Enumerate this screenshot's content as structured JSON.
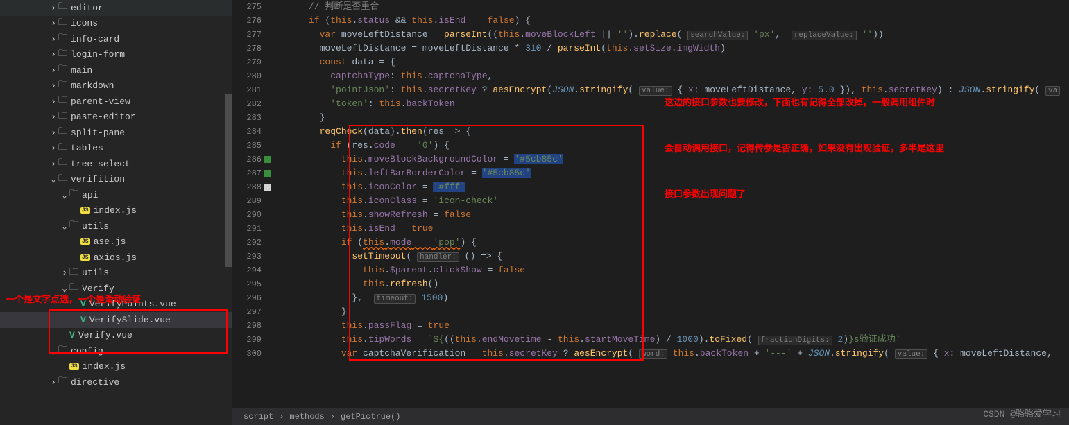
{
  "sidebar": {
    "items": [
      {
        "label": "editor",
        "type": "folder",
        "chevron": "right",
        "indent": 1
      },
      {
        "label": "icons",
        "type": "folder",
        "chevron": "right",
        "indent": 1
      },
      {
        "label": "info-card",
        "type": "folder",
        "chevron": "right",
        "indent": 1
      },
      {
        "label": "login-form",
        "type": "folder",
        "chevron": "right",
        "indent": 1
      },
      {
        "label": "main",
        "type": "folder",
        "chevron": "right",
        "indent": 1
      },
      {
        "label": "markdown",
        "type": "folder",
        "chevron": "right",
        "indent": 1
      },
      {
        "label": "parent-view",
        "type": "folder",
        "chevron": "right",
        "indent": 1
      },
      {
        "label": "paste-editor",
        "type": "folder",
        "chevron": "right",
        "indent": 1
      },
      {
        "label": "split-pane",
        "type": "folder",
        "chevron": "right",
        "indent": 1
      },
      {
        "label": "tables",
        "type": "folder",
        "chevron": "right",
        "indent": 1
      },
      {
        "label": "tree-select",
        "type": "folder",
        "chevron": "right",
        "indent": 1
      },
      {
        "label": "verifition",
        "type": "folder",
        "chevron": "down",
        "indent": 1
      },
      {
        "label": "api",
        "type": "folder",
        "chevron": "down",
        "indent": 2
      },
      {
        "label": "index.js",
        "type": "js",
        "indent": 3
      },
      {
        "label": "utils",
        "type": "folder",
        "chevron": "down",
        "indent": 2
      },
      {
        "label": "ase.js",
        "type": "js",
        "indent": 3
      },
      {
        "label": "axios.js",
        "type": "js",
        "indent": 3
      },
      {
        "label": "utils",
        "type": "folder",
        "chevron": "right",
        "indent": 2
      },
      {
        "label": "Verify",
        "type": "folder",
        "chevron": "down",
        "indent": 2
      },
      {
        "label": "VerifyPoints.vue",
        "type": "vue",
        "indent": 3
      },
      {
        "label": "VerifySlide.vue",
        "type": "vue",
        "indent": 3,
        "selected": true
      },
      {
        "label": "Verify.vue",
        "type": "vue",
        "indent": 2
      },
      {
        "label": "config",
        "type": "folder",
        "chevron": "down",
        "indent": 1
      },
      {
        "label": "index.js",
        "type": "js",
        "indent": 2
      },
      {
        "label": "directive",
        "type": "folder",
        "chevron": "right",
        "indent": 1
      }
    ]
  },
  "annotations": {
    "left": "一个是文字点选，一个是滑动验证",
    "right_line1": "这边的接口参数也要修改，下面也有记得全部改掉，一般调用组件时",
    "right_line2": "会自动调用接口，记得传参是否正确，如果没有出现验证，多半是这里",
    "right_line3": "接口参数出现问题了"
  },
  "gutter": {
    "start": 275,
    "end": 300,
    "markers": {
      "286": "green",
      "287": "green",
      "288": "white"
    }
  },
  "code": {
    "lines": [
      {
        "n": 275,
        "indent": 0,
        "tokens": [
          [
            "comment",
            "// 判断是否重合"
          ]
        ]
      },
      {
        "n": 276,
        "indent": 0,
        "tokens": [
          [
            "keyword",
            "if"
          ],
          [
            "op",
            " ("
          ],
          [
            "this",
            "this"
          ],
          [
            "op",
            "."
          ],
          [
            "prop",
            "status"
          ],
          [
            "op",
            " && "
          ],
          [
            "this",
            "this"
          ],
          [
            "op",
            "."
          ],
          [
            "prop",
            "isEnd"
          ],
          [
            "op",
            " == "
          ],
          [
            "keyword",
            "false"
          ],
          [
            "op",
            ") {"
          ]
        ]
      },
      {
        "n": 277,
        "indent": 1,
        "tokens": [
          [
            "keyword",
            "var"
          ],
          [
            "var",
            " moveLeftDistance = "
          ],
          [
            "func",
            "parseInt"
          ],
          [
            "op",
            "(("
          ],
          [
            "this",
            "this"
          ],
          [
            "op",
            "."
          ],
          [
            "prop",
            "moveBlockLeft"
          ],
          [
            "op",
            " || "
          ],
          [
            "string",
            "''"
          ],
          [
            "op",
            ")."
          ],
          [
            "func",
            "replace"
          ],
          [
            "op",
            "( "
          ],
          [
            "param",
            "searchValue:"
          ],
          [
            "string",
            " 'px'"
          ],
          [
            "op",
            ",  "
          ],
          [
            "param",
            "replaceValue:"
          ],
          [
            "string",
            " ''"
          ],
          [
            "op",
            "))"
          ]
        ]
      },
      {
        "n": 278,
        "indent": 1,
        "tokens": [
          [
            "var",
            "moveLeftDistance = moveLeftDistance * "
          ],
          [
            "number",
            "310"
          ],
          [
            "var",
            " / "
          ],
          [
            "func",
            "parseInt"
          ],
          [
            "op",
            "("
          ],
          [
            "this",
            "this"
          ],
          [
            "op",
            "."
          ],
          [
            "prop",
            "setSize"
          ],
          [
            "op",
            "."
          ],
          [
            "prop",
            "imgWidth"
          ],
          [
            "op",
            ")"
          ]
        ]
      },
      {
        "n": 279,
        "indent": 1,
        "tokens": [
          [
            "keyword",
            "const"
          ],
          [
            "var",
            " data = {"
          ]
        ]
      },
      {
        "n": 280,
        "indent": 2,
        "tokens": [
          [
            "prop",
            "captchaType"
          ],
          [
            "op",
            ": "
          ],
          [
            "this",
            "this"
          ],
          [
            "op",
            "."
          ],
          [
            "prop",
            "captchaType"
          ],
          [
            "op",
            ","
          ]
        ]
      },
      {
        "n": 281,
        "indent": 2,
        "tokens": [
          [
            "string",
            "'pointJson'"
          ],
          [
            "op",
            ": "
          ],
          [
            "this",
            "this"
          ],
          [
            "op",
            "."
          ],
          [
            "prop",
            "secretKey"
          ],
          [
            "op",
            " ? "
          ],
          [
            "func",
            "aesEncrypt"
          ],
          [
            "op",
            "("
          ],
          [
            "type",
            "JSON"
          ],
          [
            "op",
            "."
          ],
          [
            "func",
            "stringify"
          ],
          [
            "op",
            "( "
          ],
          [
            "param",
            "value:"
          ],
          [
            "op",
            " { "
          ],
          [
            "prop",
            "x"
          ],
          [
            "op",
            ": moveLeftDistance, "
          ],
          [
            "prop",
            "y"
          ],
          [
            "op",
            ": "
          ],
          [
            "number",
            "5.0"
          ],
          [
            "op",
            " }), "
          ],
          [
            "this",
            "this"
          ],
          [
            "op",
            "."
          ],
          [
            "prop",
            "secretKey"
          ],
          [
            "op",
            ") : "
          ],
          [
            "type",
            "JSON"
          ],
          [
            "op",
            "."
          ],
          [
            "func",
            "stringify"
          ],
          [
            "op",
            "( "
          ],
          [
            "param",
            "va"
          ]
        ]
      },
      {
        "n": 282,
        "indent": 2,
        "tokens": [
          [
            "string",
            "'token'"
          ],
          [
            "op",
            ": "
          ],
          [
            "this",
            "this"
          ],
          [
            "op",
            "."
          ],
          [
            "prop",
            "backToken"
          ]
        ]
      },
      {
        "n": 283,
        "indent": 1,
        "tokens": [
          [
            "op",
            "}"
          ]
        ]
      },
      {
        "n": 284,
        "indent": 1,
        "tokens": [
          [
            "func",
            "reqCheck"
          ],
          [
            "op",
            "(data)."
          ],
          [
            "func",
            "then"
          ],
          [
            "op",
            "("
          ],
          [
            "var",
            "res"
          ],
          [
            "op",
            " => {"
          ]
        ]
      },
      {
        "n": 285,
        "indent": 2,
        "tokens": [
          [
            "keyword",
            "if"
          ],
          [
            "op",
            " ("
          ],
          [
            "var",
            "res"
          ],
          [
            "op",
            "."
          ],
          [
            "prop",
            "code"
          ],
          [
            "op",
            " == "
          ],
          [
            "string",
            "'0'"
          ],
          [
            "op",
            ") {"
          ]
        ]
      },
      {
        "n": 286,
        "indent": 3,
        "tokens": [
          [
            "this",
            "this"
          ],
          [
            "op",
            "."
          ],
          [
            "prop",
            "moveBlockBackgroundColor"
          ],
          [
            "op",
            " = "
          ],
          [
            "string-hl",
            "'#5cb85c'"
          ]
        ]
      },
      {
        "n": 287,
        "indent": 3,
        "tokens": [
          [
            "this",
            "this"
          ],
          [
            "op",
            "."
          ],
          [
            "prop",
            "leftBarBorderColor"
          ],
          [
            "op",
            " = "
          ],
          [
            "string-hl",
            "'#5cb85c'"
          ]
        ]
      },
      {
        "n": 288,
        "indent": 3,
        "tokens": [
          [
            "this",
            "this"
          ],
          [
            "op",
            "."
          ],
          [
            "prop",
            "iconColor"
          ],
          [
            "op",
            " = "
          ],
          [
            "string-hl",
            "'#fff'"
          ]
        ]
      },
      {
        "n": 289,
        "indent": 3,
        "tokens": [
          [
            "this",
            "this"
          ],
          [
            "op",
            "."
          ],
          [
            "prop",
            "iconClass"
          ],
          [
            "op",
            " = "
          ],
          [
            "string",
            "'icon-check'"
          ]
        ]
      },
      {
        "n": 290,
        "indent": 3,
        "tokens": [
          [
            "this",
            "this"
          ],
          [
            "op",
            "."
          ],
          [
            "prop",
            "showRefresh"
          ],
          [
            "op",
            " = "
          ],
          [
            "keyword",
            "false"
          ]
        ]
      },
      {
        "n": 291,
        "indent": 3,
        "tokens": [
          [
            "this",
            "this"
          ],
          [
            "op",
            "."
          ],
          [
            "prop",
            "isEnd"
          ],
          [
            "op",
            " = "
          ],
          [
            "keyword",
            "true"
          ]
        ]
      },
      {
        "n": 292,
        "indent": 3,
        "tokens": [
          [
            "keyword",
            "if"
          ],
          [
            "op",
            " ("
          ],
          [
            "this-u",
            "this"
          ],
          [
            "op-u",
            "."
          ],
          [
            "prop-u",
            "mode"
          ],
          [
            "op-u",
            " == "
          ],
          [
            "string-u",
            "'pop'"
          ],
          [
            "op",
            ") {"
          ]
        ]
      },
      {
        "n": 293,
        "indent": 4,
        "tokens": [
          [
            "func",
            "setTimeout"
          ],
          [
            "op",
            "( "
          ],
          [
            "param",
            "handler:"
          ],
          [
            "op",
            " () => {"
          ]
        ]
      },
      {
        "n": 294,
        "indent": 5,
        "tokens": [
          [
            "this",
            "this"
          ],
          [
            "op",
            "."
          ],
          [
            "prop",
            "$parent"
          ],
          [
            "op",
            "."
          ],
          [
            "prop",
            "clickShow"
          ],
          [
            "op",
            " = "
          ],
          [
            "keyword",
            "false"
          ]
        ]
      },
      {
        "n": 295,
        "indent": 5,
        "tokens": [
          [
            "this",
            "this"
          ],
          [
            "op",
            "."
          ],
          [
            "func",
            "refresh"
          ],
          [
            "op",
            "()"
          ]
        ]
      },
      {
        "n": 296,
        "indent": 4,
        "tokens": [
          [
            "op",
            "},  "
          ],
          [
            "param",
            "timeout:"
          ],
          [
            "number",
            " 1500"
          ],
          [
            "op",
            ")"
          ]
        ]
      },
      {
        "n": 297,
        "indent": 3,
        "tokens": [
          [
            "op",
            "}"
          ]
        ]
      },
      {
        "n": 298,
        "indent": 3,
        "tokens": [
          [
            "this",
            "this"
          ],
          [
            "op",
            "."
          ],
          [
            "prop",
            "passFlag"
          ],
          [
            "op",
            " = "
          ],
          [
            "keyword",
            "true"
          ]
        ]
      },
      {
        "n": 299,
        "indent": 3,
        "tokens": [
          [
            "this",
            "this"
          ],
          [
            "op",
            "."
          ],
          [
            "prop",
            "tipWords"
          ],
          [
            "op",
            " = "
          ],
          [
            "string",
            "`${"
          ],
          [
            "op",
            "(("
          ],
          [
            "this",
            "this"
          ],
          [
            "op",
            "."
          ],
          [
            "prop",
            "endMovetime"
          ],
          [
            "op",
            " - "
          ],
          [
            "this",
            "this"
          ],
          [
            "op",
            "."
          ],
          [
            "prop",
            "startMoveTime"
          ],
          [
            "op",
            ") / "
          ],
          [
            "number",
            "1000"
          ],
          [
            "op",
            ")."
          ],
          [
            "func",
            "toFixed"
          ],
          [
            "op",
            "( "
          ],
          [
            "param",
            "fractionDigits:"
          ],
          [
            "number",
            " 2"
          ],
          [
            "op",
            ")"
          ],
          [
            "string",
            "}s验证成功`"
          ]
        ]
      },
      {
        "n": 300,
        "indent": 3,
        "tokens": [
          [
            "keyword",
            "var"
          ],
          [
            "var",
            " captchaVerification = "
          ],
          [
            "this",
            "this"
          ],
          [
            "op",
            "."
          ],
          [
            "prop",
            "secretKey"
          ],
          [
            "op",
            " ? "
          ],
          [
            "func",
            "aesEncrypt"
          ],
          [
            "op",
            "( "
          ],
          [
            "param",
            "word:"
          ],
          [
            "op",
            " "
          ],
          [
            "this",
            "this"
          ],
          [
            "op",
            "."
          ],
          [
            "prop",
            "backToken"
          ],
          [
            "op",
            " + "
          ],
          [
            "string",
            "'---'"
          ],
          [
            "op",
            " + "
          ],
          [
            "type",
            "JSON"
          ],
          [
            "op",
            "."
          ],
          [
            "func",
            "stringify"
          ],
          [
            "op",
            "( "
          ],
          [
            "param",
            "value:"
          ],
          [
            "op",
            " { "
          ],
          [
            "prop",
            "x"
          ],
          [
            "op",
            ": moveLeftDistance, "
          ]
        ]
      }
    ]
  },
  "breadcrumb": {
    "items": [
      "script",
      "methods",
      "getPictrue()"
    ]
  },
  "watermark": "CSDN @骆骆爱学习"
}
